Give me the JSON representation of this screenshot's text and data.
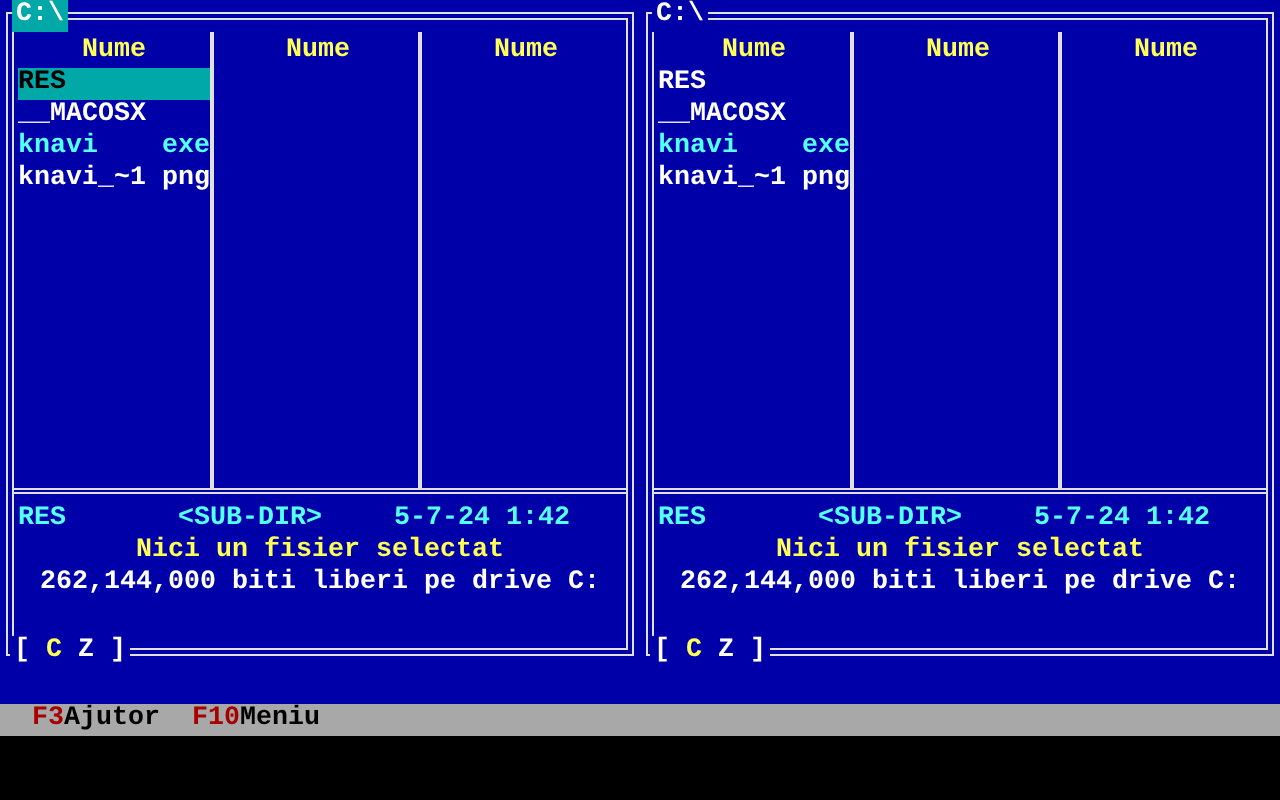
{
  "panels": [
    {
      "path": "C:\\",
      "active": true,
      "columns": [
        "Nume",
        "Nume",
        "Nume"
      ],
      "files": [
        {
          "name": "RES",
          "kind": "dir",
          "selected": true
        },
        {
          "name": "__MACOSX",
          "kind": "dir",
          "selected": false
        },
        {
          "name": "knavi",
          "ext": "exe",
          "kind": "exe",
          "selected": false
        },
        {
          "name": "knavi_~1",
          "ext": "png",
          "kind": "file",
          "selected": false
        }
      ],
      "info": {
        "name": "RES",
        "size": "<SUB-DIR>",
        "date": "5-7-24",
        "time": "1:42"
      },
      "selection": "Nici un fisier selectat",
      "free": "262,144,000 biti liberi pe drive C:",
      "drive_bar": {
        "open": "[",
        "drives": [
          {
            "label": "C",
            "selected": true
          },
          {
            "label": "Z",
            "selected": false
          }
        ],
        "close": "]"
      }
    },
    {
      "path": "C:\\",
      "active": false,
      "columns": [
        "Nume",
        "Nume",
        "Nume"
      ],
      "files": [
        {
          "name": "RES",
          "kind": "dir",
          "selected": false
        },
        {
          "name": "__MACOSX",
          "kind": "dir",
          "selected": false
        },
        {
          "name": "knavi",
          "ext": "exe",
          "kind": "exe",
          "selected": false
        },
        {
          "name": "knavi_~1",
          "ext": "png",
          "kind": "file",
          "selected": false
        }
      ],
      "info": {
        "name": "RES",
        "size": "<SUB-DIR>",
        "date": "5-7-24",
        "time": "1:42"
      },
      "selection": "Nici un fisier selectat",
      "free": "262,144,000 biti liberi pe drive C:",
      "drive_bar": {
        "open": "[",
        "drives": [
          {
            "label": "C",
            "selected": true
          },
          {
            "label": "Z",
            "selected": false
          }
        ],
        "close": "]"
      }
    }
  ],
  "function_keys": [
    {
      "key": "F3",
      "label": "Ajutor"
    },
    {
      "key": "F10",
      "label": "Meniu"
    }
  ]
}
